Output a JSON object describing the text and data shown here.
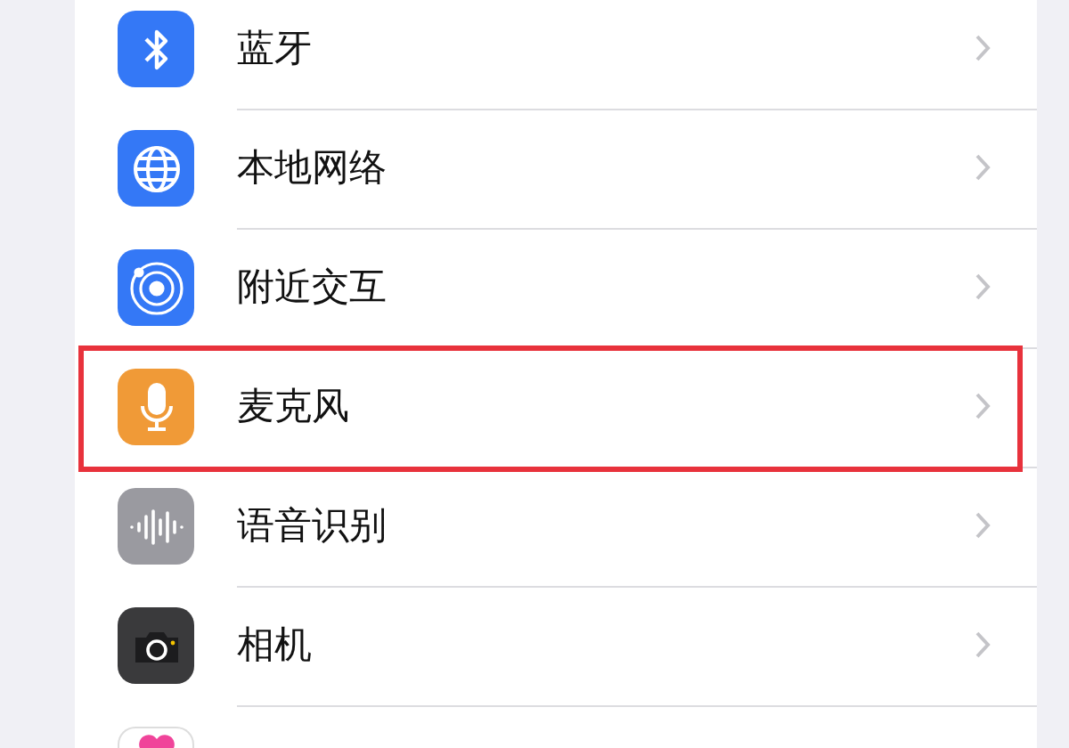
{
  "settings_list": [
    {
      "kind": "bluetooth",
      "label": "蓝牙",
      "highlighted": false
    },
    {
      "kind": "globe",
      "label": "本地网络",
      "highlighted": false
    },
    {
      "kind": "nearby",
      "label": "附近交互",
      "highlighted": false
    },
    {
      "kind": "microphone",
      "label": "麦克风",
      "highlighted": true
    },
    {
      "kind": "waveform",
      "label": "语音识别",
      "highlighted": false
    },
    {
      "kind": "camera",
      "label": "相机",
      "highlighted": false
    },
    {
      "kind": "heart"
    }
  ]
}
